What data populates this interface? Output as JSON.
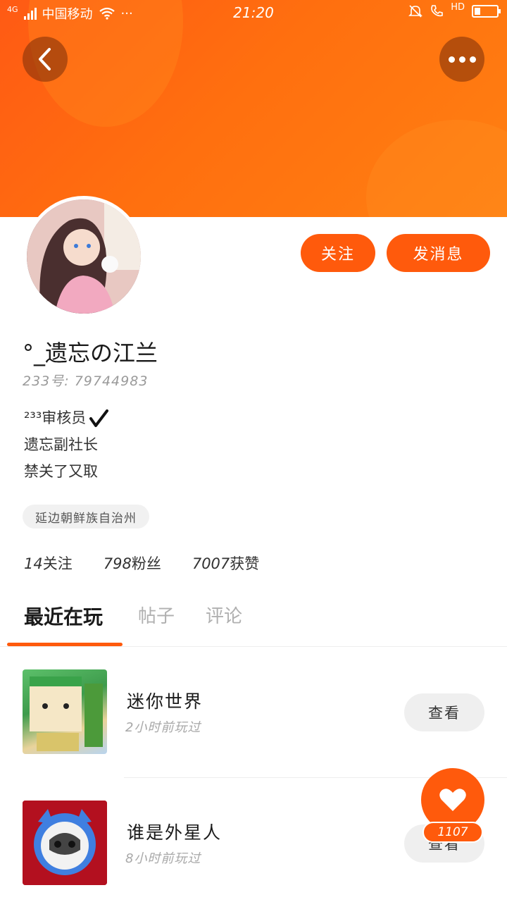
{
  "statusbar": {
    "network": "4G",
    "carrier": "中国移动",
    "time": "21:20",
    "extra_dots": "···",
    "hd": "HD",
    "battery_level": 0.2
  },
  "header": {
    "back_icon": "chevron-left-icon",
    "more_icon": "more-dots-icon"
  },
  "profile": {
    "follow_label": "关注",
    "message_label": "发消息",
    "username": "°_遗忘の江兰",
    "uid": "233号: 79744983",
    "bio": [
      "²³³审核员",
      "遗忘副社长",
      "禁关了又取"
    ],
    "region": "延边朝鲜族自治州",
    "stats": [
      {
        "num": "14",
        "label": "关注"
      },
      {
        "num": "798",
        "label": "粉丝"
      },
      {
        "num": "7007",
        "label": "获赞"
      }
    ]
  },
  "tabs": [
    "最近在玩",
    "帖子",
    "评论"
  ],
  "games": [
    {
      "title": "迷你世界",
      "time": "2小时前玩过",
      "action": "查看"
    },
    {
      "title": "谁是外星人",
      "time": "8小时前玩过",
      "action": "查看"
    }
  ],
  "like": {
    "count": "1107"
  },
  "colors": {
    "accent": "#ff5a0c",
    "header_start": "#ff5a14",
    "header_end": "#ff8012"
  }
}
